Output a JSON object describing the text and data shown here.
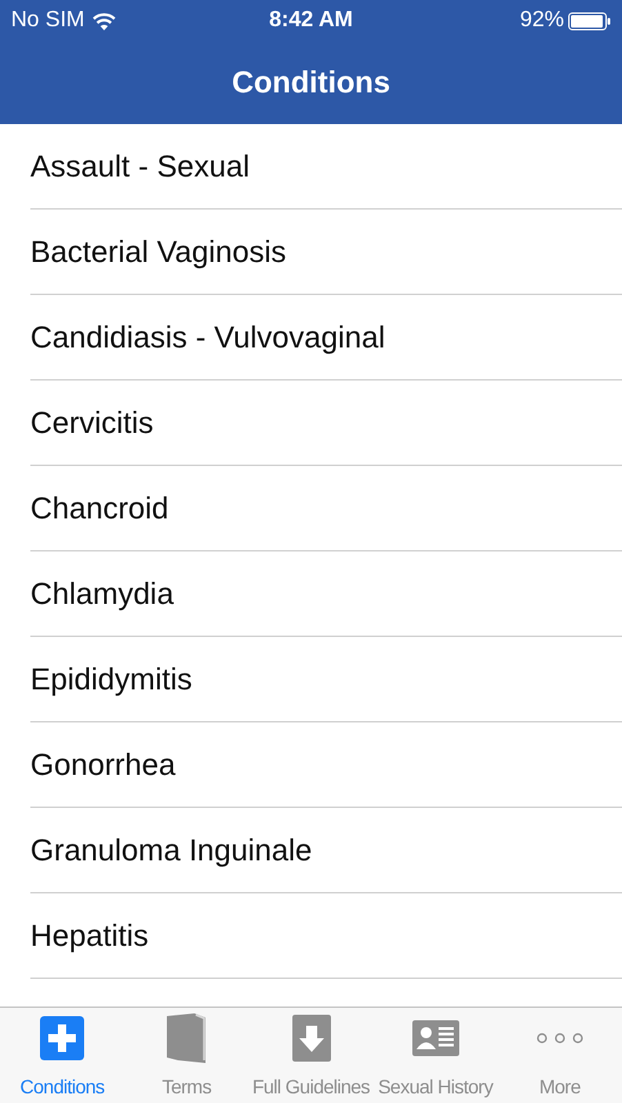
{
  "status_bar": {
    "carrier": "No SIM",
    "time": "8:42 AM",
    "battery": "92%"
  },
  "nav_bar": {
    "title": "Conditions"
  },
  "conditions": [
    {
      "label": "Assault - Sexual"
    },
    {
      "label": "Bacterial Vaginosis"
    },
    {
      "label": "Candidiasis - Vulvovaginal"
    },
    {
      "label": "Cervicitis"
    },
    {
      "label": "Chancroid"
    },
    {
      "label": "Chlamydia"
    },
    {
      "label": "Epididymitis"
    },
    {
      "label": "Gonorrhea"
    },
    {
      "label": "Granuloma Inguinale"
    },
    {
      "label": "Hepatitis"
    }
  ],
  "tab_bar": [
    {
      "kind": "plus",
      "label": "Conditions",
      "selected": true
    },
    {
      "kind": "book",
      "label": "Terms",
      "selected": false
    },
    {
      "kind": "download",
      "label": "Full Guidelines",
      "selected": false
    },
    {
      "kind": "card",
      "label": "Sexual History",
      "selected": false
    },
    {
      "kind": "more",
      "label": "More",
      "selected": false
    }
  ]
}
